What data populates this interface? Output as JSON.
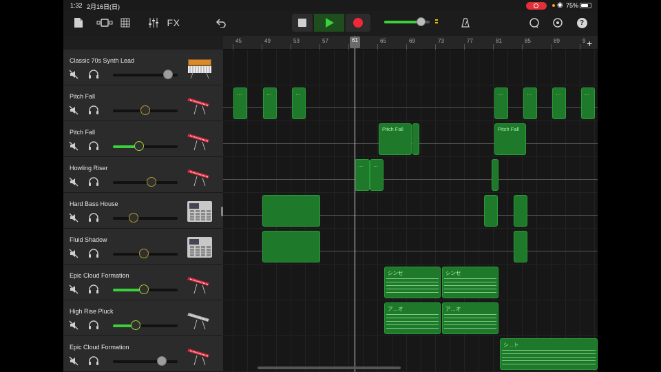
{
  "status": {
    "time": "1:32",
    "date": "2月16日(日)",
    "battery": "75%",
    "recording_color": "#e0313a"
  },
  "toolbar": {
    "fx_label": "FX",
    "icons": [
      "document-icon",
      "view-toggle-icon",
      "grid-icon",
      "mixer-icon",
      "undo-icon",
      "metronome-icon",
      "loop-icon",
      "settings-icon",
      "help-icon"
    ],
    "help_glyph": "?",
    "master_volume": 0.82
  },
  "ruler": {
    "bars": [
      "45",
      "49",
      "53",
      "57",
      "61",
      "65",
      "69",
      "73",
      "77",
      "81",
      "85",
      "89",
      "9"
    ],
    "playhead": "61"
  },
  "tracks": [
    {
      "name": "Classic 70s Synth Lead",
      "volume": 0.85,
      "knob": "gray",
      "instrument": "synth-keyboard-icon"
    },
    {
      "name": "Pitch Fall",
      "volume": 0.5,
      "knob": "dark",
      "instrument": "red-keyboard-icon"
    },
    {
      "name": "Pitch Fall",
      "volume": 0.4,
      "knob": "green",
      "instrument": "red-keyboard-icon"
    },
    {
      "name": "Howling Riser",
      "volume": 0.6,
      "knob": "dark",
      "instrument": "red-keyboard-icon"
    },
    {
      "name": "Hard Bass House",
      "volume": 0.32,
      "knob": "dark",
      "instrument": "drum-machine-icon"
    },
    {
      "name": "Fluid Shadow",
      "volume": 0.48,
      "knob": "dark",
      "instrument": "drum-machine-icon"
    },
    {
      "name": "Epic Cloud Formation",
      "volume": 0.48,
      "knob": "green",
      "instrument": "red-keyboard-icon"
    },
    {
      "name": "High Rise Pluck",
      "volume": 0.35,
      "knob": "green",
      "instrument": "silver-keyboard-icon"
    },
    {
      "name": "Epic Cloud Formation",
      "volume": 0.75,
      "knob": "gray",
      "instrument": "red-keyboard-icon"
    }
  ],
  "regions": [
    {
      "track": 1,
      "label": "…"
    },
    {
      "track": 1,
      "label": "…"
    },
    {
      "track": 1,
      "label": "…"
    },
    {
      "track": 1,
      "label": "…"
    },
    {
      "track": 1,
      "label": "…"
    },
    {
      "track": 1,
      "label": "…"
    },
    {
      "track": 1,
      "label": "…"
    },
    {
      "track": 2,
      "label": "Pitch Fall"
    },
    {
      "track": 2,
      "label": ""
    },
    {
      "track": 2,
      "label": "Pitch Fall"
    },
    {
      "track": 3,
      "label": "…"
    },
    {
      "track": 3,
      "label": "…"
    },
    {
      "track": 3,
      "label": ""
    },
    {
      "track": 4,
      "label": ""
    },
    {
      "track": 4,
      "label": ""
    },
    {
      "track": 4,
      "label": ""
    },
    {
      "track": 5,
      "label": ""
    },
    {
      "track": 5,
      "label": ""
    },
    {
      "track": 6,
      "label": "シンセ"
    },
    {
      "track": 6,
      "label": "シンセ"
    },
    {
      "track": 7,
      "label": "ア…オ"
    },
    {
      "track": 7,
      "label": "ア…オ"
    },
    {
      "track": 8,
      "label": "シ…ト"
    }
  ]
}
